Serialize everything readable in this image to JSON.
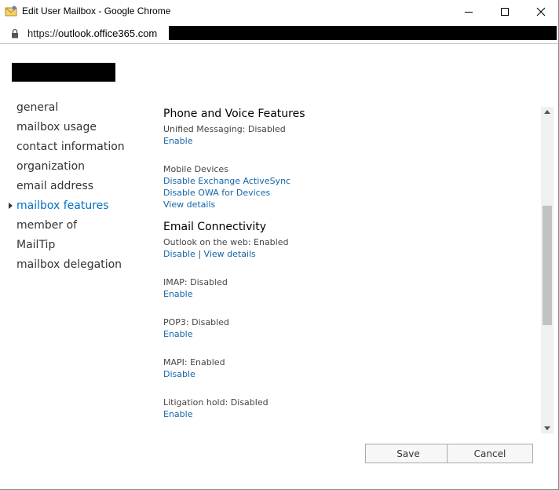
{
  "window": {
    "title": "Edit User Mailbox - Google Chrome",
    "icon": "mail-envelope-icon",
    "minimize_icon": "minimize-icon",
    "maximize_icon": "maximize-icon",
    "close_icon": "close-icon"
  },
  "address": {
    "scheme": "https://",
    "host": "outlook.office365.com"
  },
  "nav": {
    "items": [
      {
        "label": "general"
      },
      {
        "label": "mailbox usage"
      },
      {
        "label": "contact information"
      },
      {
        "label": "organization"
      },
      {
        "label": "email address"
      },
      {
        "label": "mailbox features",
        "active": true
      },
      {
        "label": "member of"
      },
      {
        "label": "MailTip"
      },
      {
        "label": "mailbox delegation"
      }
    ]
  },
  "content": {
    "phone_title": "Phone and Voice Features",
    "um_status": "Unified Messaging: Disabled",
    "um_enable": "Enable",
    "mobile_label": "Mobile Devices",
    "mobile_disable_eas": "Disable Exchange ActiveSync",
    "mobile_disable_owa": "Disable OWA for Devices",
    "mobile_view": "View details",
    "email_title": "Email Connectivity",
    "owa_status": "Outlook on the web: Enabled",
    "owa_disable": "Disable",
    "owa_sep": "|",
    "owa_view": "View details",
    "imap_status": "IMAP: Disabled",
    "imap_enable": "Enable",
    "pop_status": "POP3: Disabled",
    "pop_enable": "Enable",
    "mapi_status": "MAPI: Enabled",
    "mapi_disable": "Disable",
    "lit_status": "Litigation hold: Disabled",
    "lit_enable": "Enable"
  },
  "buttons": {
    "save": "Save",
    "cancel": "Cancel"
  },
  "colors": {
    "link": "#1565a8",
    "active_nav": "#0072c6"
  }
}
